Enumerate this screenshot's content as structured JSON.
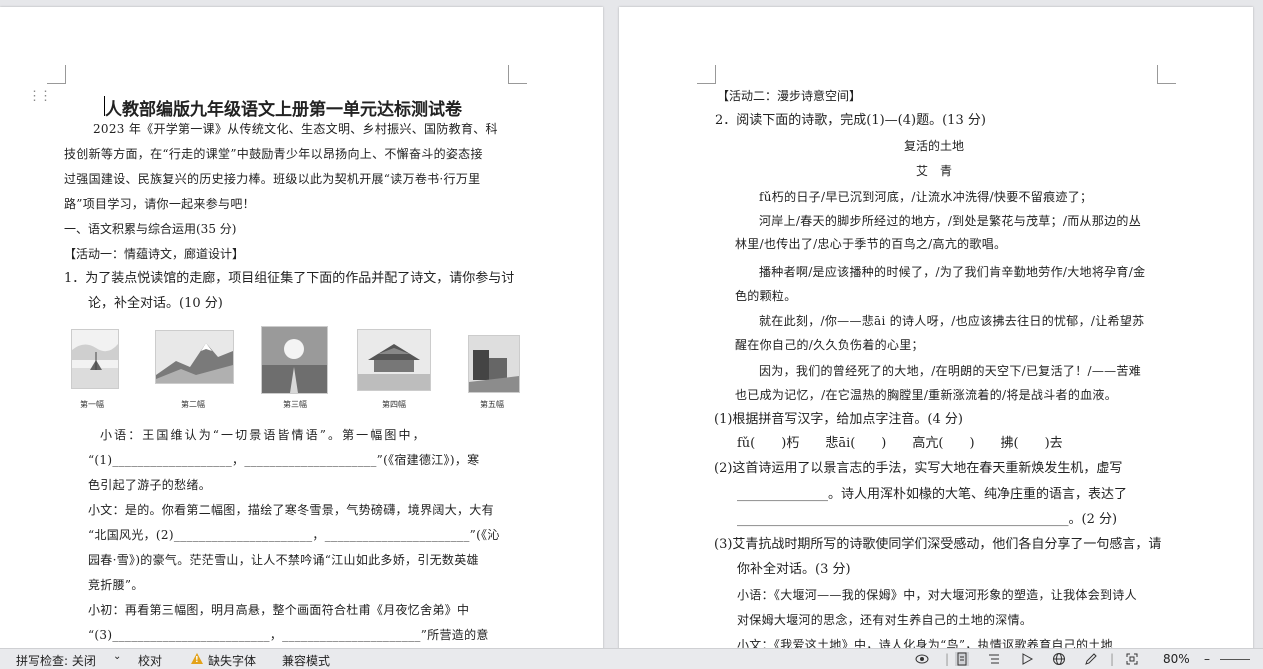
{
  "page1": {
    "title": "人教部编版九年级语文上册第一单元达标测试卷",
    "intro": [
      "2023 年《开学第一课》从传统文化、生态文明、乡村振兴、国防教育、科",
      "技创新等方面，在“行走的课堂”中鼓励青少年以昂扬向上、不懈奋斗的姿态接",
      "过强国建设、民族复兴的历史接力棒。班级以此为契机开展“读万卷书·行万里",
      "路”项目学习，请你一起来参与吧！"
    ],
    "section1": "一、语文积累与综合运用(35 分)",
    "activity1": "【活动一：情蕴诗文，廊道设计】",
    "q1": [
      "1．为了装点悦读馆的走廊，项目组征集了下面的作品并配了诗文，请你参与讨",
      "论，补全对话。(10 分)"
    ],
    "captions": [
      "第一幅",
      "第二幅",
      "第三幅",
      "第四幅",
      "第五幅"
    ],
    "dialog": [
      "小语：王国维认为“一切景语皆情语”。第一幅图中，",
      "“(1)___________________，_____________________”(《宿建德江》)，寒",
      "色引起了游子的愁绪。",
      "小文：是的。你看第二幅图，描绘了寒冬雪景，气势磅礴，境界阔大，大有",
      "“北国风光，(2)______________________，_______________________”(《沁",
      "园春·雪》)的豪气。茫茫雪山，让人不禁吟诵“江山如此多娇，引无数英雄",
      "竞折腰”。",
      "小初：再看第三幅图，明月高悬，整个画面符合杜甫《月夜忆舍弟》中",
      "“(3)_________________________，______________________”所营造的意"
    ]
  },
  "page2": {
    "activity2": "【活动二：漫步诗意空间】",
    "q2": "2．阅读下面的诗歌，完成(1)—(4)题。(13 分)",
    "poem_title": "复活的土地",
    "poet": "艾　青",
    "poem": [
      "fǔ朽的日子/早已沉到河底，/让流水冲洗得/快要不留痕迹了；",
      "河岸上/春天的脚步所经过的地方，/到处是繁花与茂草；/而从那边的丛",
      "林里/也传出了/忠心于季节的百鸟之/高亢的歌唱。",
      "播种者啊/是应该播种的时候了，/为了我们肯辛勤地劳作/大地将孕育/金",
      "色的颗粒。",
      "就在此刻，/你——悲āi 的诗人呀，/也应该拂去往日的忧郁，/让希望苏",
      "醒在你自己的/久久负伤着的心里；",
      "因为，我们的曾经死了的大地，/在明朗的天空下/已复活了！/——苦难",
      "也已成为记忆，/在它温热的胸膛里/重新涨流着的/将是战斗者的血液。"
    ],
    "sub1": "(1)根据拼音写汉字，给加点字注音。(4 分)",
    "pinyin": "fǔ(　　)朽　　悲āi(　　)　　高亢(　　)　　拂(　　)去",
    "sub2": [
      "(2)这首诗运用了以景言志的手法，实写大地在春天重新焕发生机，虚写",
      "______________。诗人用浑朴如椽的大笔、纯净庄重的语言，表达了",
      "___________________________________________________。(2 分)"
    ],
    "sub3": [
      "(3)艾青抗战时期所写的诗歌使同学们深受感动，他们各自分享了一句感言，请",
      "你补全对话。(3 分)"
    ],
    "talk": [
      "小语：《大堰河——我的保姆》中，对大堰河形象的塑造，让我体会到诗人",
      "对保姆大堰河的思念，还有对生养自己的土地的深情。",
      "小文：《我爱这土地》中，诗人化身为“鸟”，执情讴歌养育自己的土地"
    ]
  },
  "status": {
    "spell": "拼写检查: 关闭",
    "proof": "校对",
    "missing_font": "缺失字体",
    "compat": "兼容模式",
    "zoom": "80%"
  }
}
